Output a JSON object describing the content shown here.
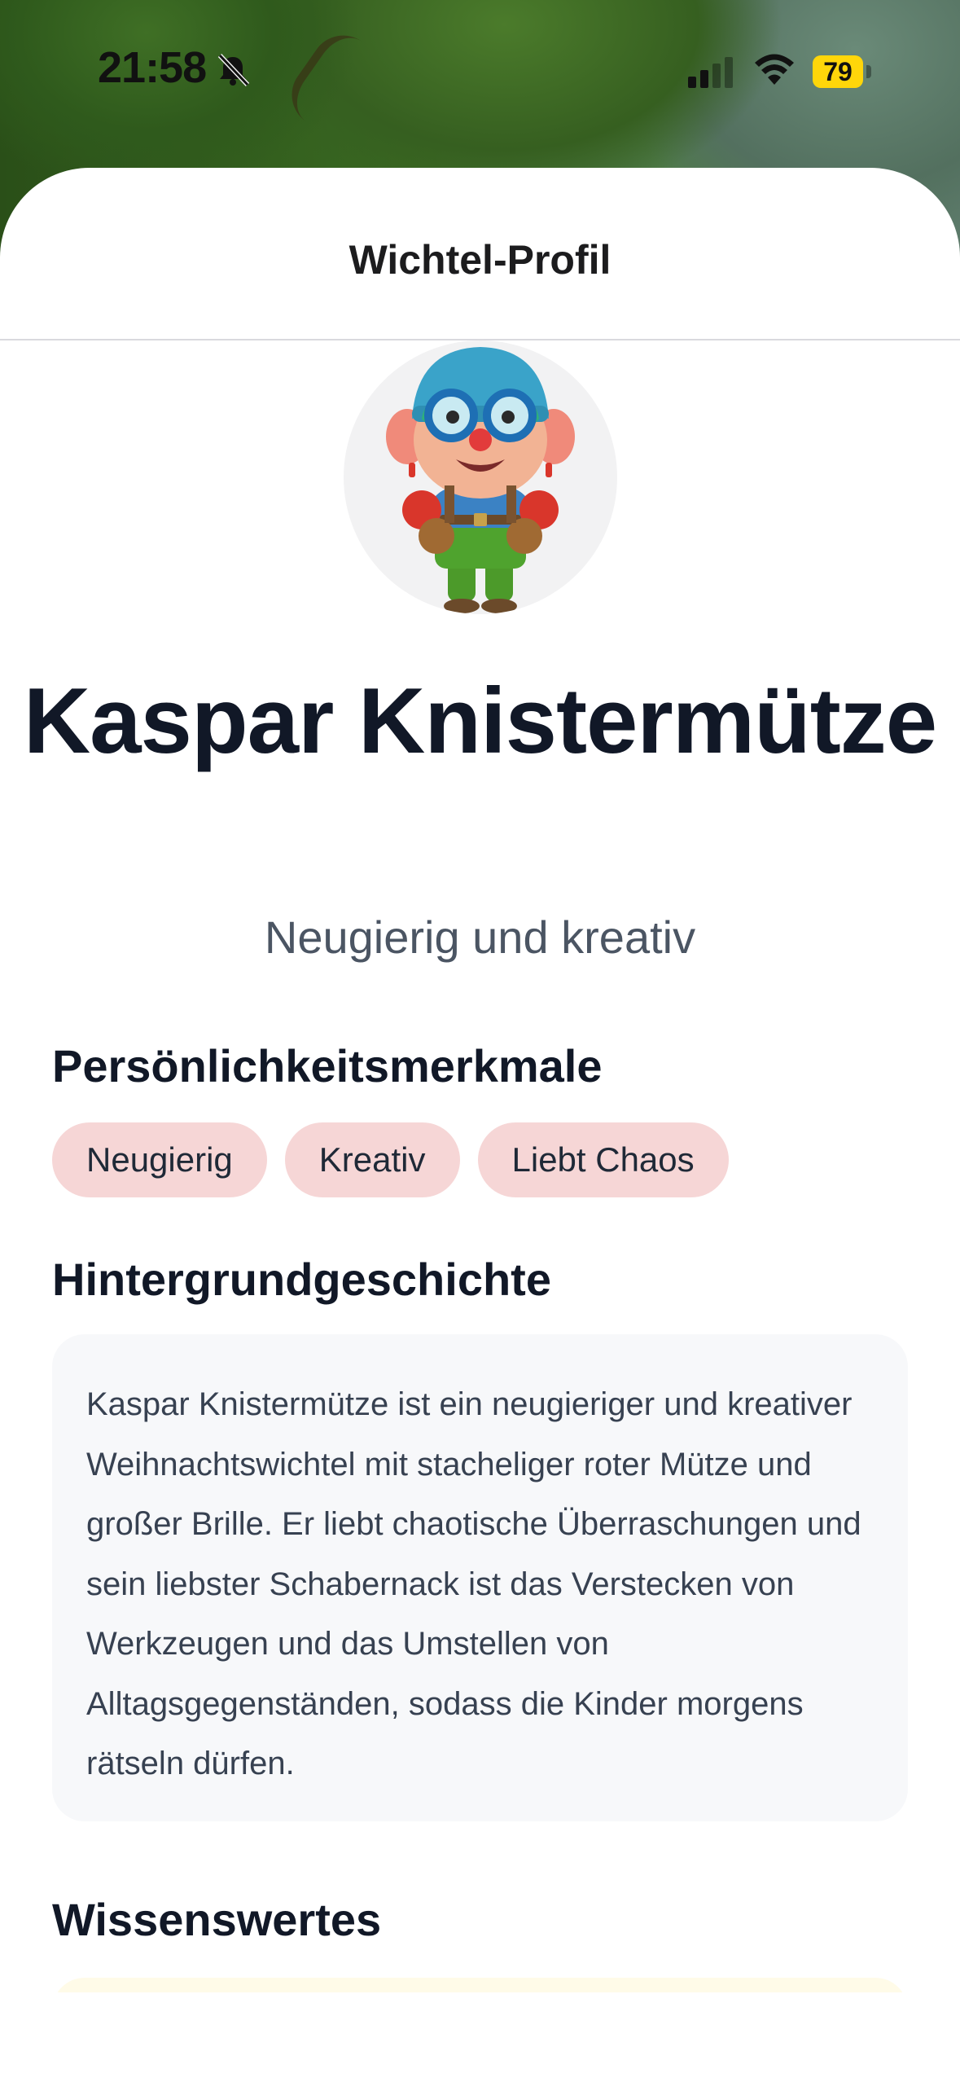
{
  "status_bar": {
    "time": "21:58",
    "battery": "79"
  },
  "header": {
    "title": "Wichtel-Profil"
  },
  "profile": {
    "name": "Kaspar Knistermütze",
    "tagline": "Neugierig und kreativ",
    "avatar_icon": "elf-avatar-image"
  },
  "traits": {
    "title": "Persönlichkeitsmerkmale",
    "items": [
      "Neugierig",
      "Kreativ",
      "Liebt Chaos"
    ]
  },
  "backstory": {
    "title": "Hintergrundgeschichte",
    "text": "Kaspar Knistermütze ist ein neugieriger und kreativer Weihnachtswichtel mit stacheliger roter Mütze und großer Brille. Er liebt chaotische Überraschungen und sein liebster Schabernack ist das Verstecken von Werkzeugen und das Umstellen von Alltagsgegenständen, sodass die Kinder morgens rätseln dürfen."
  },
  "facts": {
    "title": "Wissenswertes"
  },
  "colors": {
    "chip_bg": "#f6d6d6",
    "story_bg": "#f7f8fa",
    "facts_bg": "#fffbe8",
    "battery": "#ffd60a"
  }
}
